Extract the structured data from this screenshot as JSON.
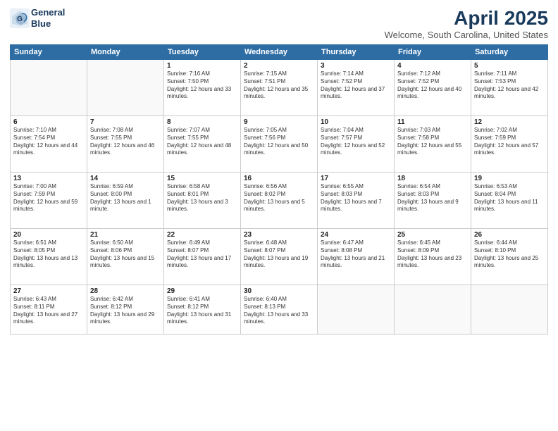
{
  "logo": {
    "line1": "General",
    "line2": "Blue"
  },
  "title": "April 2025",
  "location": "Welcome, South Carolina, United States",
  "weekdays": [
    "Sunday",
    "Monday",
    "Tuesday",
    "Wednesday",
    "Thursday",
    "Friday",
    "Saturday"
  ],
  "weeks": [
    [
      {
        "num": "",
        "sunrise": "",
        "sunset": "",
        "daylight": "",
        "empty": true
      },
      {
        "num": "",
        "sunrise": "",
        "sunset": "",
        "daylight": "",
        "empty": true
      },
      {
        "num": "1",
        "sunrise": "Sunrise: 7:16 AM",
        "sunset": "Sunset: 7:50 PM",
        "daylight": "Daylight: 12 hours and 33 minutes."
      },
      {
        "num": "2",
        "sunrise": "Sunrise: 7:15 AM",
        "sunset": "Sunset: 7:51 PM",
        "daylight": "Daylight: 12 hours and 35 minutes."
      },
      {
        "num": "3",
        "sunrise": "Sunrise: 7:14 AM",
        "sunset": "Sunset: 7:52 PM",
        "daylight": "Daylight: 12 hours and 37 minutes."
      },
      {
        "num": "4",
        "sunrise": "Sunrise: 7:12 AM",
        "sunset": "Sunset: 7:52 PM",
        "daylight": "Daylight: 12 hours and 40 minutes."
      },
      {
        "num": "5",
        "sunrise": "Sunrise: 7:11 AM",
        "sunset": "Sunset: 7:53 PM",
        "daylight": "Daylight: 12 hours and 42 minutes."
      }
    ],
    [
      {
        "num": "6",
        "sunrise": "Sunrise: 7:10 AM",
        "sunset": "Sunset: 7:54 PM",
        "daylight": "Daylight: 12 hours and 44 minutes."
      },
      {
        "num": "7",
        "sunrise": "Sunrise: 7:08 AM",
        "sunset": "Sunset: 7:55 PM",
        "daylight": "Daylight: 12 hours and 46 minutes."
      },
      {
        "num": "8",
        "sunrise": "Sunrise: 7:07 AM",
        "sunset": "Sunset: 7:55 PM",
        "daylight": "Daylight: 12 hours and 48 minutes."
      },
      {
        "num": "9",
        "sunrise": "Sunrise: 7:05 AM",
        "sunset": "Sunset: 7:56 PM",
        "daylight": "Daylight: 12 hours and 50 minutes."
      },
      {
        "num": "10",
        "sunrise": "Sunrise: 7:04 AM",
        "sunset": "Sunset: 7:57 PM",
        "daylight": "Daylight: 12 hours and 52 minutes."
      },
      {
        "num": "11",
        "sunrise": "Sunrise: 7:03 AM",
        "sunset": "Sunset: 7:58 PM",
        "daylight": "Daylight: 12 hours and 55 minutes."
      },
      {
        "num": "12",
        "sunrise": "Sunrise: 7:02 AM",
        "sunset": "Sunset: 7:59 PM",
        "daylight": "Daylight: 12 hours and 57 minutes."
      }
    ],
    [
      {
        "num": "13",
        "sunrise": "Sunrise: 7:00 AM",
        "sunset": "Sunset: 7:59 PM",
        "daylight": "Daylight: 12 hours and 59 minutes."
      },
      {
        "num": "14",
        "sunrise": "Sunrise: 6:59 AM",
        "sunset": "Sunset: 8:00 PM",
        "daylight": "Daylight: 13 hours and 1 minute."
      },
      {
        "num": "15",
        "sunrise": "Sunrise: 6:58 AM",
        "sunset": "Sunset: 8:01 PM",
        "daylight": "Daylight: 13 hours and 3 minutes."
      },
      {
        "num": "16",
        "sunrise": "Sunrise: 6:56 AM",
        "sunset": "Sunset: 8:02 PM",
        "daylight": "Daylight: 13 hours and 5 minutes."
      },
      {
        "num": "17",
        "sunrise": "Sunrise: 6:55 AM",
        "sunset": "Sunset: 8:03 PM",
        "daylight": "Daylight: 13 hours and 7 minutes."
      },
      {
        "num": "18",
        "sunrise": "Sunrise: 6:54 AM",
        "sunset": "Sunset: 8:03 PM",
        "daylight": "Daylight: 13 hours and 9 minutes."
      },
      {
        "num": "19",
        "sunrise": "Sunrise: 6:53 AM",
        "sunset": "Sunset: 8:04 PM",
        "daylight": "Daylight: 13 hours and 11 minutes."
      }
    ],
    [
      {
        "num": "20",
        "sunrise": "Sunrise: 6:51 AM",
        "sunset": "Sunset: 8:05 PM",
        "daylight": "Daylight: 13 hours and 13 minutes."
      },
      {
        "num": "21",
        "sunrise": "Sunrise: 6:50 AM",
        "sunset": "Sunset: 8:06 PM",
        "daylight": "Daylight: 13 hours and 15 minutes."
      },
      {
        "num": "22",
        "sunrise": "Sunrise: 6:49 AM",
        "sunset": "Sunset: 8:07 PM",
        "daylight": "Daylight: 13 hours and 17 minutes."
      },
      {
        "num": "23",
        "sunrise": "Sunrise: 6:48 AM",
        "sunset": "Sunset: 8:07 PM",
        "daylight": "Daylight: 13 hours and 19 minutes."
      },
      {
        "num": "24",
        "sunrise": "Sunrise: 6:47 AM",
        "sunset": "Sunset: 8:08 PM",
        "daylight": "Daylight: 13 hours and 21 minutes."
      },
      {
        "num": "25",
        "sunrise": "Sunrise: 6:45 AM",
        "sunset": "Sunset: 8:09 PM",
        "daylight": "Daylight: 13 hours and 23 minutes."
      },
      {
        "num": "26",
        "sunrise": "Sunrise: 6:44 AM",
        "sunset": "Sunset: 8:10 PM",
        "daylight": "Daylight: 13 hours and 25 minutes."
      }
    ],
    [
      {
        "num": "27",
        "sunrise": "Sunrise: 6:43 AM",
        "sunset": "Sunset: 8:11 PM",
        "daylight": "Daylight: 13 hours and 27 minutes."
      },
      {
        "num": "28",
        "sunrise": "Sunrise: 6:42 AM",
        "sunset": "Sunset: 8:12 PM",
        "daylight": "Daylight: 13 hours and 29 minutes."
      },
      {
        "num": "29",
        "sunrise": "Sunrise: 6:41 AM",
        "sunset": "Sunset: 8:12 PM",
        "daylight": "Daylight: 13 hours and 31 minutes."
      },
      {
        "num": "30",
        "sunrise": "Sunrise: 6:40 AM",
        "sunset": "Sunset: 8:13 PM",
        "daylight": "Daylight: 13 hours and 33 minutes."
      },
      {
        "num": "",
        "sunrise": "",
        "sunset": "",
        "daylight": "",
        "empty": true
      },
      {
        "num": "",
        "sunrise": "",
        "sunset": "",
        "daylight": "",
        "empty": true
      },
      {
        "num": "",
        "sunrise": "",
        "sunset": "",
        "daylight": "",
        "empty": true
      }
    ]
  ]
}
